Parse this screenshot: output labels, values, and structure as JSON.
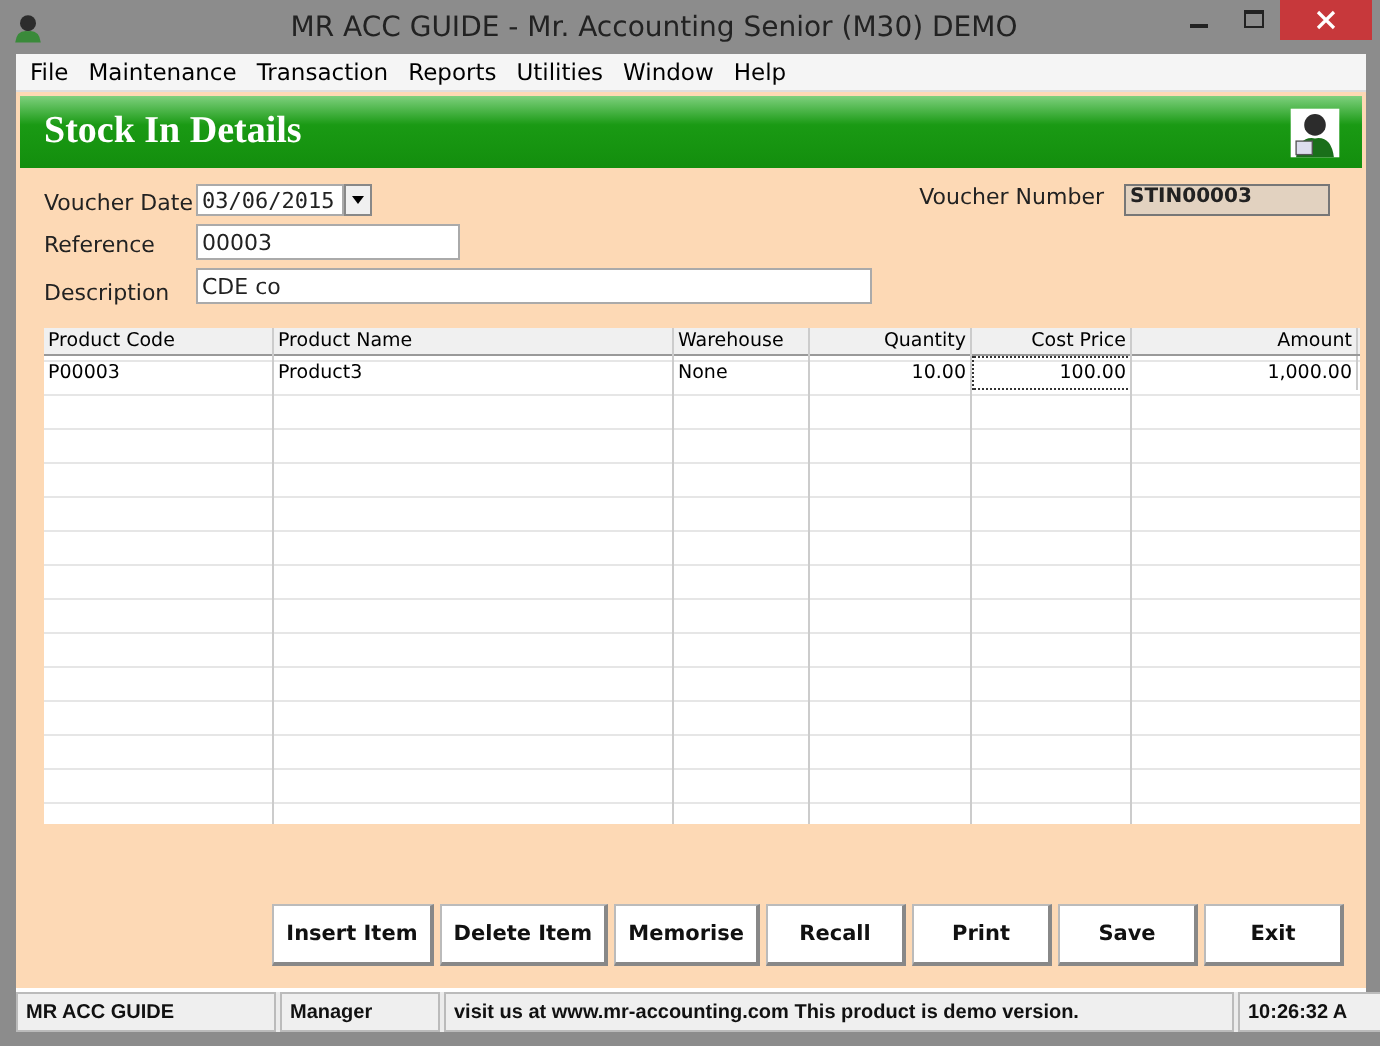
{
  "window": {
    "title": "MR ACC GUIDE - Mr. Accounting Senior (M30) DEMO"
  },
  "menu": [
    "File",
    "Maintenance",
    "Transaction",
    "Reports",
    "Utilities",
    "Window",
    "Help"
  ],
  "header": {
    "title": "Stock In Details"
  },
  "form": {
    "voucher_date": {
      "label": "Voucher Date",
      "value": "03/06/2015"
    },
    "reference": {
      "label": "Reference",
      "value": "00003"
    },
    "description": {
      "label": "Description",
      "value": "CDE co"
    },
    "voucher_number": {
      "label": "Voucher Number",
      "value": "STIN00003"
    }
  },
  "table": {
    "columns": [
      {
        "label": "Product Code"
      },
      {
        "label": "Product Name"
      },
      {
        "label": "Warehouse"
      },
      {
        "label": "Quantity"
      },
      {
        "label": "Cost Price"
      },
      {
        "label": "Amount"
      }
    ],
    "rows": [
      {
        "cells": [
          {
            "text": "P00003",
            "selected": false
          },
          {
            "text": "Product3",
            "selected": false
          },
          {
            "text": "None",
            "selected": false
          },
          {
            "text": "10.00",
            "selected": false
          },
          {
            "text": "100.00",
            "selected": true
          },
          {
            "text": "1,000.00",
            "selected": false
          }
        ]
      }
    ]
  },
  "buttons": [
    "Insert Item",
    "Delete Item",
    "Memorise",
    "Recall",
    "Print",
    "Save",
    "Exit"
  ],
  "status_bar": [
    "MR ACC GUIDE",
    "Manager",
    "visit us at www.mr-accounting.com This product is demo version.",
    "10:26:32 A"
  ]
}
